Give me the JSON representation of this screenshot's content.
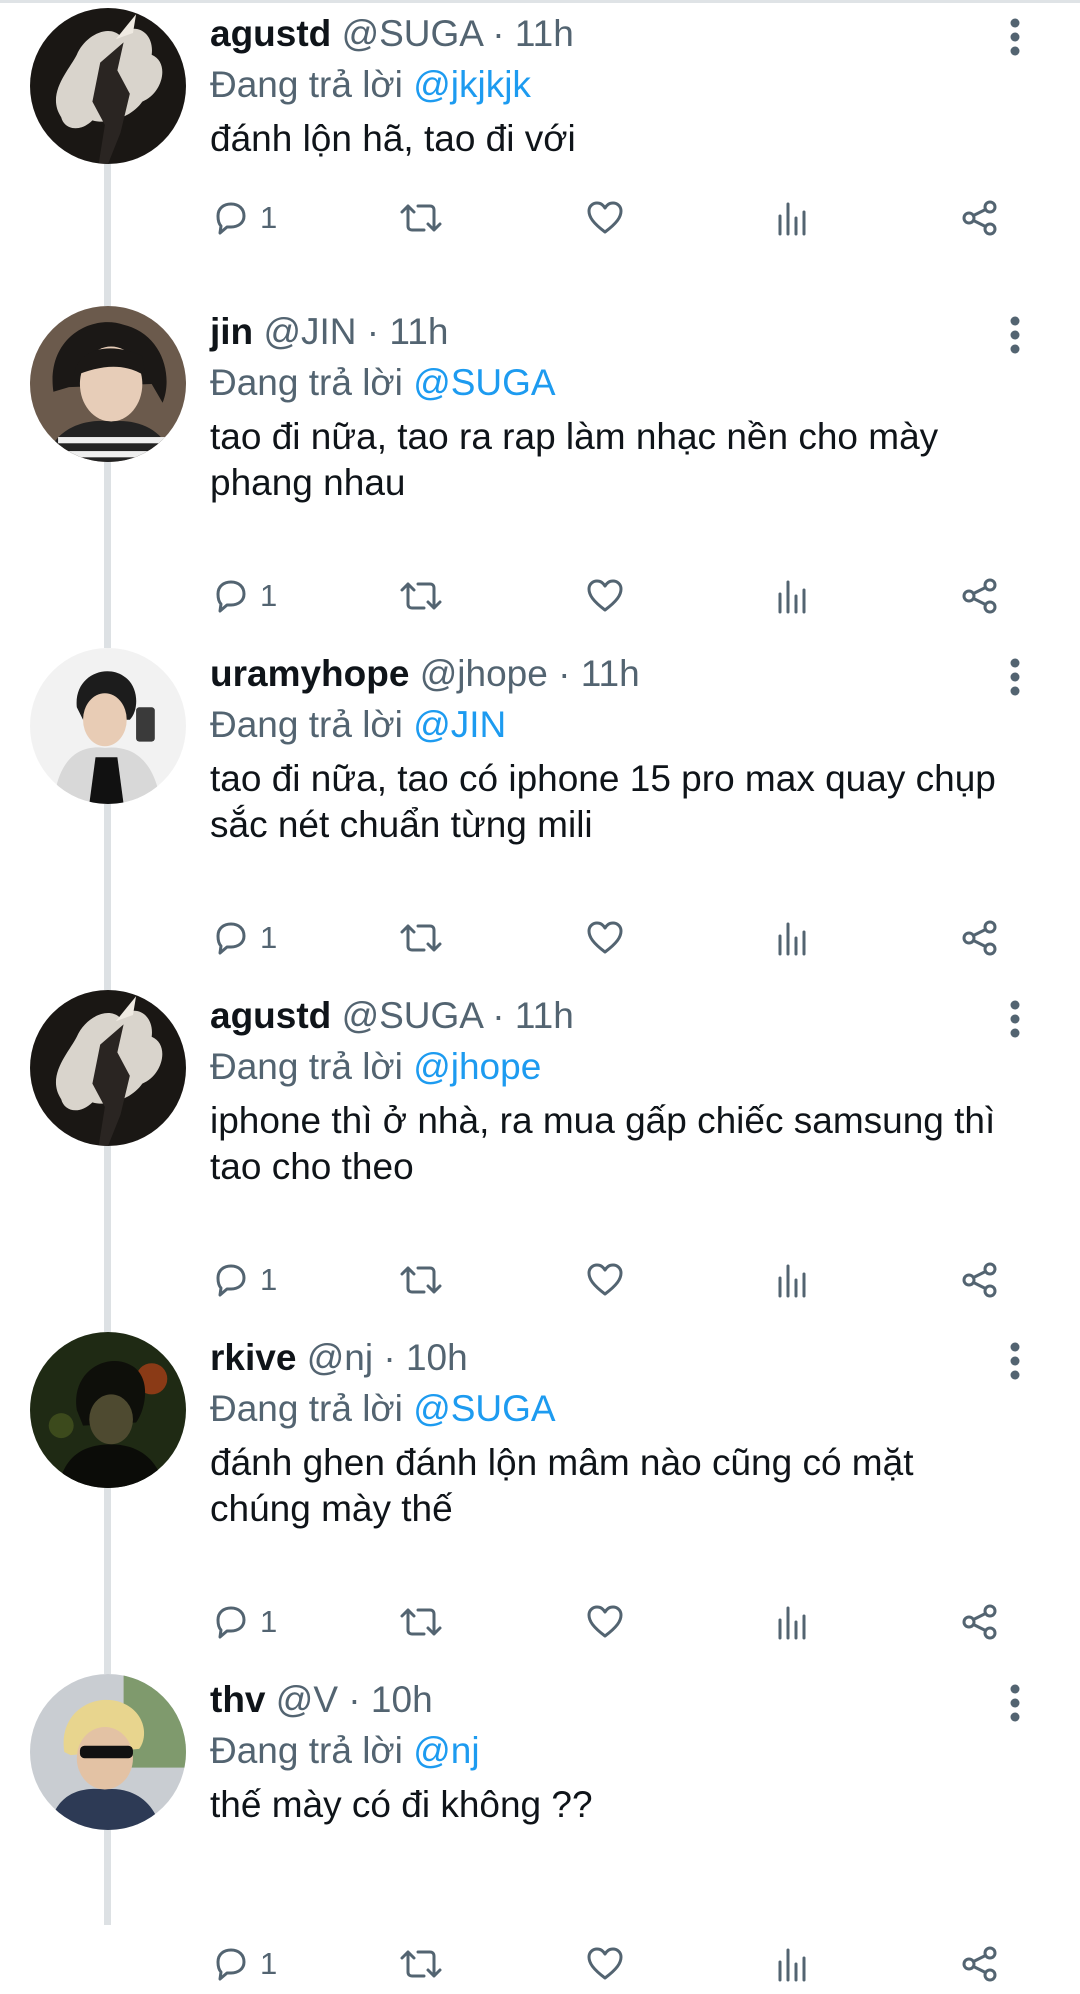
{
  "reply_prefix": "Đang trả lời",
  "tweets": [
    {
      "name": "agustd",
      "handle": "@SUGA",
      "time": "11h",
      "reply_to": "@jkjkjk",
      "text": "đánh lộn hã, tao đi với",
      "replies": "1",
      "avatar": "smoke-silhouette"
    },
    {
      "name": "jin",
      "handle": "@JIN",
      "time": "11h",
      "reply_to": "@SUGA",
      "text": "tao đi nữa, tao ra rap làm nhạc nền cho mày phang nhau",
      "replies": "1",
      "avatar": "dark-hair-portrait"
    },
    {
      "name": "uramyhope",
      "handle": "@jhope",
      "time": "11h",
      "reply_to": "@JIN",
      "text": "tao đi nữa, tao có iphone 15 pro max quay chụp sắc nét chuẩn từng mili",
      "replies": "1",
      "avatar": "selfie-portrait"
    },
    {
      "name": "agustd",
      "handle": "@SUGA",
      "time": "11h",
      "reply_to": "@jhope",
      "text": "iphone thì ở nhà, ra mua gấp chiếc samsung thì tao cho theo",
      "replies": "1",
      "avatar": "smoke-silhouette"
    },
    {
      "name": "rkive",
      "handle": "@nj",
      "time": "10h",
      "reply_to": "@SUGA",
      "text": "đánh ghen đánh lộn mâm nào cũng có mặt chúng mày thế",
      "replies": "1",
      "avatar": "dim-lit-portrait"
    },
    {
      "name": "thv",
      "handle": "@V",
      "time": "10h",
      "reply_to": "@nj",
      "text": "thế mày có đi không ??",
      "replies": "1",
      "avatar": "sunglasses-portrait"
    }
  ],
  "icons": {
    "reply": "reply-icon",
    "retweet": "retweet-icon",
    "like": "heart-icon",
    "views": "views-icon",
    "share": "share-icon",
    "more": "more-icon"
  },
  "colors": {
    "accent": "#1d9bf0",
    "text": "#0f1419",
    "secondary": "#536471",
    "thread_line": "#dde1e4"
  }
}
